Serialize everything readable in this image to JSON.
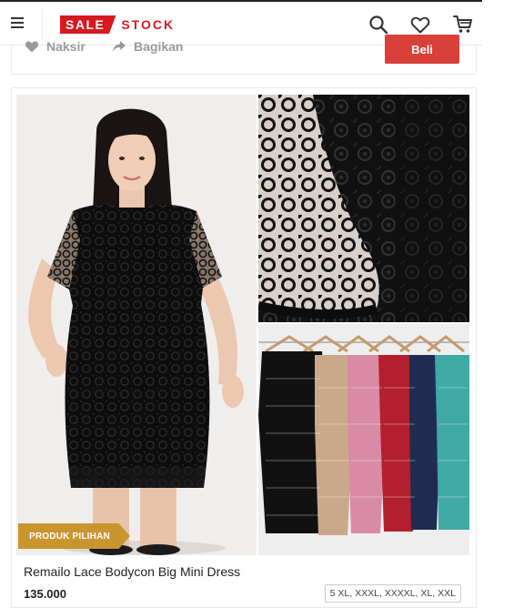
{
  "header": {
    "logo_part1": "SALE",
    "logo_part2": "STOCK",
    "icons": [
      "menu-icon",
      "search-icon",
      "heart-icon",
      "cart-icon"
    ],
    "brand_color": "#d71920"
  },
  "previous_item": {
    "naksir_label": "Naksir",
    "bagikan_label": "Bagikan",
    "beli_label": "Beli",
    "beli_color": "#d9403a"
  },
  "product": {
    "badge": "PRODUK PILIHAN",
    "badge_color": "#c8952f",
    "name": "Remailo Lace Bodycon Big Mini Dress",
    "price": "135.000",
    "sizes": "5 XL, XXXL, XXXXL, XL, XXL",
    "variant_colors": [
      "#111111",
      "#c9a98a",
      "#d98aa5",
      "#b31f2e",
      "#1f2c52",
      "#3fa9a4"
    ]
  }
}
